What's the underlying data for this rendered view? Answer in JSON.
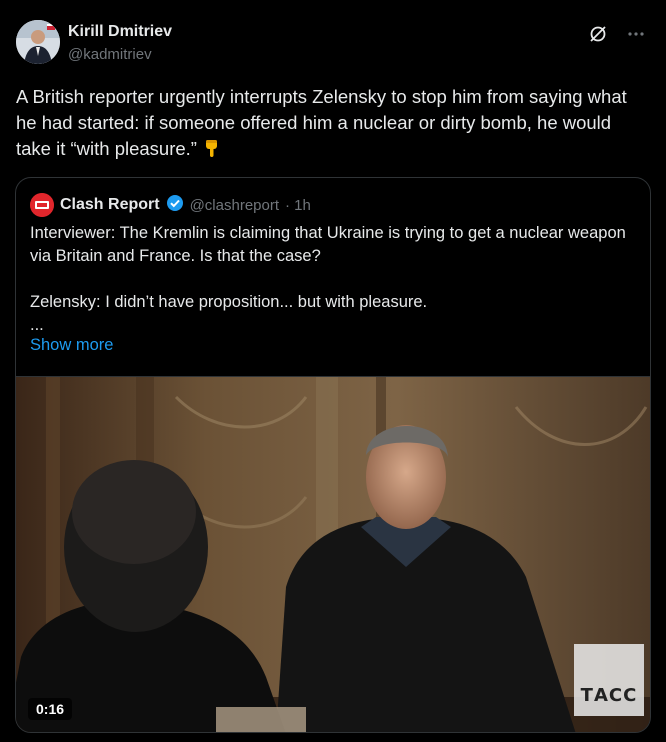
{
  "author": {
    "name": "Kirill Dmitriev",
    "handle": "@kadmitriev"
  },
  "post": {
    "text": "A British reporter urgently interrupts Zelensky to stop him from saying what he had started: if someone offered him a nuclear or dirty bomb, he would take it “with pleasure.”",
    "emoji": "pointing-down-emoji"
  },
  "quote": {
    "name": "Clash Report",
    "handle": "@clashreport",
    "time": "· 1h",
    "text": "Interviewer: The Kremlin is claiming that Ukraine is trying to get a nuclear weapon via Britain and France. Is that the case?\n\nZelensky: I didn’t have proposition... but with pleasure.\n...",
    "show_more": "Show more",
    "verified_color": "#1d9bf0"
  },
  "video": {
    "duration": "0:16",
    "watermark": "ТАСС"
  }
}
